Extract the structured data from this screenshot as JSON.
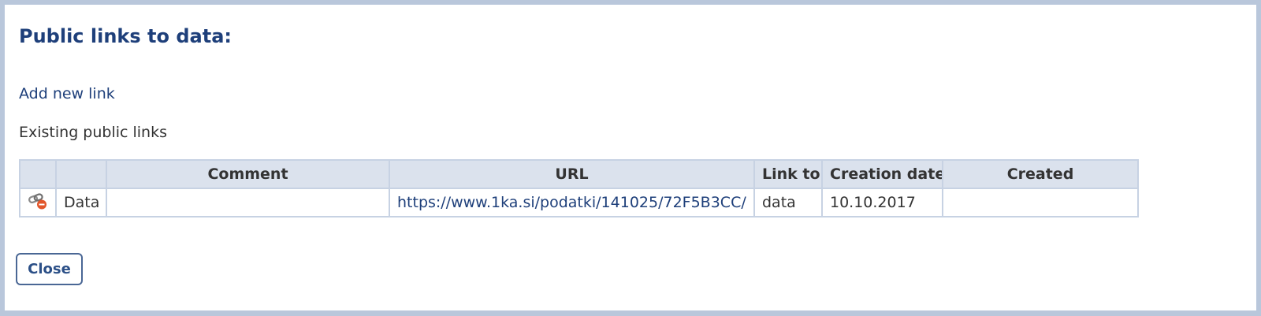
{
  "dialog": {
    "title": "Public links to data:",
    "add_link_label": "Add new link",
    "existing_label": "Existing public links",
    "table": {
      "headers": [
        "",
        "",
        "Comment",
        "URL",
        "Link to",
        "Creation date",
        "Created"
      ],
      "rows": [
        {
          "icon": "link-remove-icon",
          "type": "Data",
          "comment": "",
          "url": "https://www.1ka.si/podatki/141025/72F5B3CC/",
          "link_to": "data",
          "creation_date": "10.10.2017",
          "created": ""
        }
      ]
    },
    "close_label": "Close"
  },
  "colors": {
    "accent": "#1e3f7a",
    "header_bg": "#dbe2ed",
    "border": "#c7d2e3",
    "frame": "#b9c7db"
  }
}
